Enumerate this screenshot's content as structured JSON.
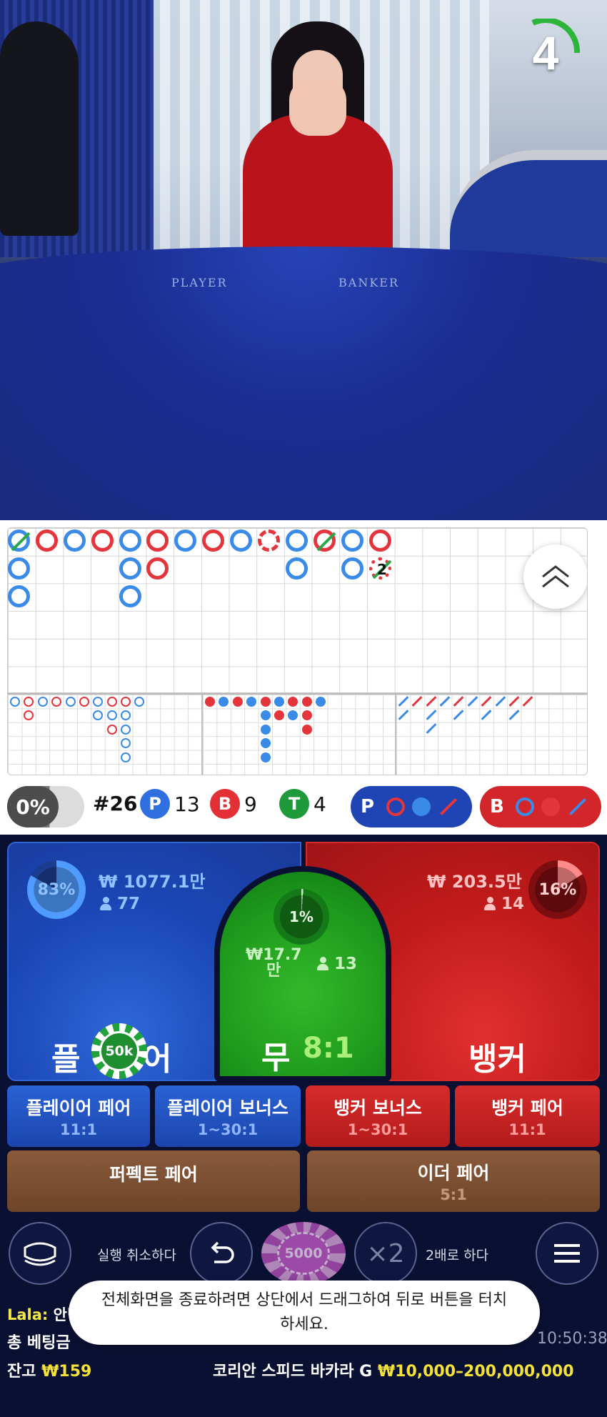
{
  "video": {
    "table_label_player": "PLAYER",
    "table_label_banker": "BANKER",
    "countdown": "4"
  },
  "scoreboard": {
    "tie_count_marker": "2",
    "shoe": "#26",
    "player_count": "13",
    "banker_count": "9",
    "tie_count": "4",
    "pct_toggle": "0%",
    "player_badge": "P",
    "banker_badge": "B",
    "tie_badge": "T",
    "predict_player_label": "P",
    "predict_banker_label": "B"
  },
  "betting": {
    "player": {
      "pct": "83%",
      "amount": "₩ 1077.1만",
      "bettors": "77",
      "title_left": "플",
      "title_right": "어",
      "chip": "50k",
      "pct_value": 0.83
    },
    "tie": {
      "pct": "1%",
      "amount": "₩17.7\n만",
      "amount_line1": "₩17.7",
      "amount_line2": "만",
      "bettors": "13",
      "title": "무",
      "odds": "8:1",
      "pct_value": 0.01
    },
    "banker": {
      "pct": "16%",
      "amount": "₩ 203.5만",
      "bettors": "14",
      "title": "뱅커",
      "pct_value": 0.16
    },
    "side_bets": [
      {
        "title": "플레이어 페어",
        "odds": "11:1"
      },
      {
        "title": "플레이어 보너스",
        "odds": "1~30:1"
      },
      {
        "title": "뱅커 보너스",
        "odds": "1~30:1"
      },
      {
        "title": "뱅커 페어",
        "odds": "11:1"
      }
    ],
    "perfect_pair": {
      "title": "퍼펙트 페어"
    },
    "either_pair": {
      "title": "이더 페어",
      "odds": "5:1"
    }
  },
  "controls": {
    "undo_label": "실행 취소하다",
    "chip_value": "5000",
    "double_symbol": "×2",
    "double_label": "2배로 하다"
  },
  "chat": {
    "name": "Lala:",
    "message": "안녕"
  },
  "toast": {
    "message": "전체화면을 종료하려면 상단에서 드래그하여 뒤로 버튼을 터치하세요."
  },
  "footer": {
    "total_bet_label": "총 베팅금",
    "time": "10:50:38",
    "balance_label": "잔고",
    "balance": "₩159",
    "table_name": "코리안 스피드 바카라 G",
    "limits": "₩10,000–200,000,000"
  },
  "colors": {
    "player": "#2f67d8",
    "banker": "#d62a2a",
    "tie": "#1e9a1c",
    "accent_yellow": "#f4e23a"
  }
}
